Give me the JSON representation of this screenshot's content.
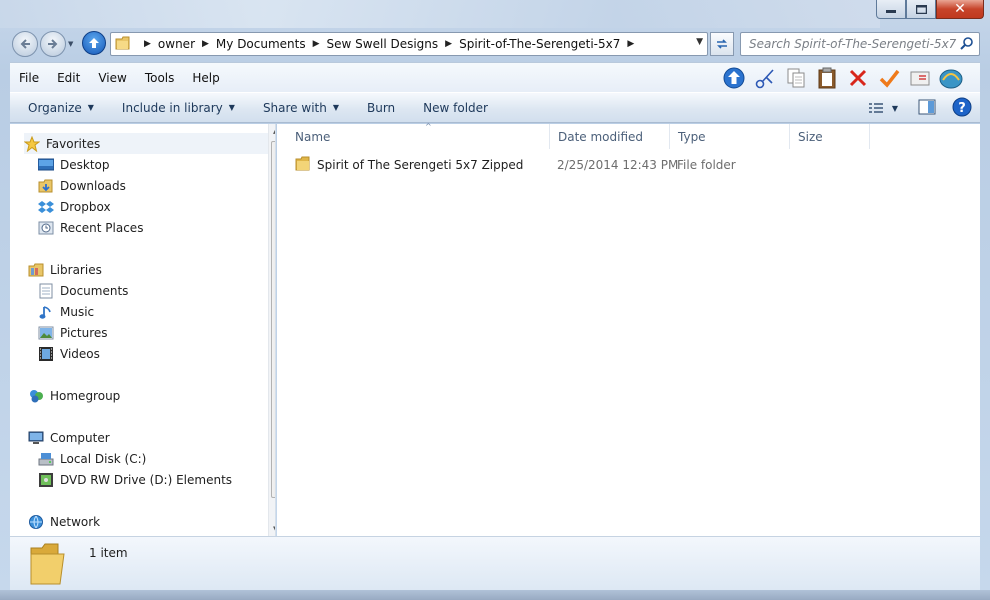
{
  "window": {
    "minimize_label": "—",
    "maximize_label": "□",
    "close_label": "✕"
  },
  "address": {
    "breadcrumbs": [
      "owner",
      "My Documents",
      "Sew Swell Designs",
      "Spirit-of-The-Serengeti-5x7"
    ],
    "search_placeholder": "Search Spirit-of-The-Serengeti-5x7"
  },
  "menu": {
    "items": [
      "File",
      "Edit",
      "View",
      "Tools",
      "Help"
    ],
    "toolbar_icons": [
      "up-icon",
      "cut-icon",
      "copy-icon",
      "paste-icon",
      "delete-icon",
      "checkmark-icon",
      "properties-icon",
      "shell-icon"
    ]
  },
  "commands": {
    "organize": "Organize",
    "include_in_library": "Include in library",
    "share_with": "Share with",
    "burn": "Burn",
    "new_folder": "New folder"
  },
  "nav_pane": {
    "favorites": {
      "label": "Favorites",
      "items": [
        "Desktop",
        "Downloads",
        "Dropbox",
        "Recent Places"
      ]
    },
    "libraries": {
      "label": "Libraries",
      "items": [
        "Documents",
        "Music",
        "Pictures",
        "Videos"
      ]
    },
    "homegroup": {
      "label": "Homegroup"
    },
    "computer": {
      "label": "Computer",
      "items": [
        "Local Disk (C:)",
        "DVD RW Drive (D:) Elements"
      ]
    },
    "network": {
      "label": "Network"
    }
  },
  "columns": {
    "name": "Name",
    "date_modified": "Date modified",
    "type": "Type",
    "size": "Size"
  },
  "files": [
    {
      "name": "Spirit of The Serengeti 5x7 Zipped",
      "date_modified": "2/25/2014 12:43 PM",
      "type": "File folder",
      "size": ""
    }
  ],
  "details": {
    "item_count": "1 item"
  },
  "colors": {
    "accent": "#1e395b",
    "folder": "#e8c35a"
  }
}
